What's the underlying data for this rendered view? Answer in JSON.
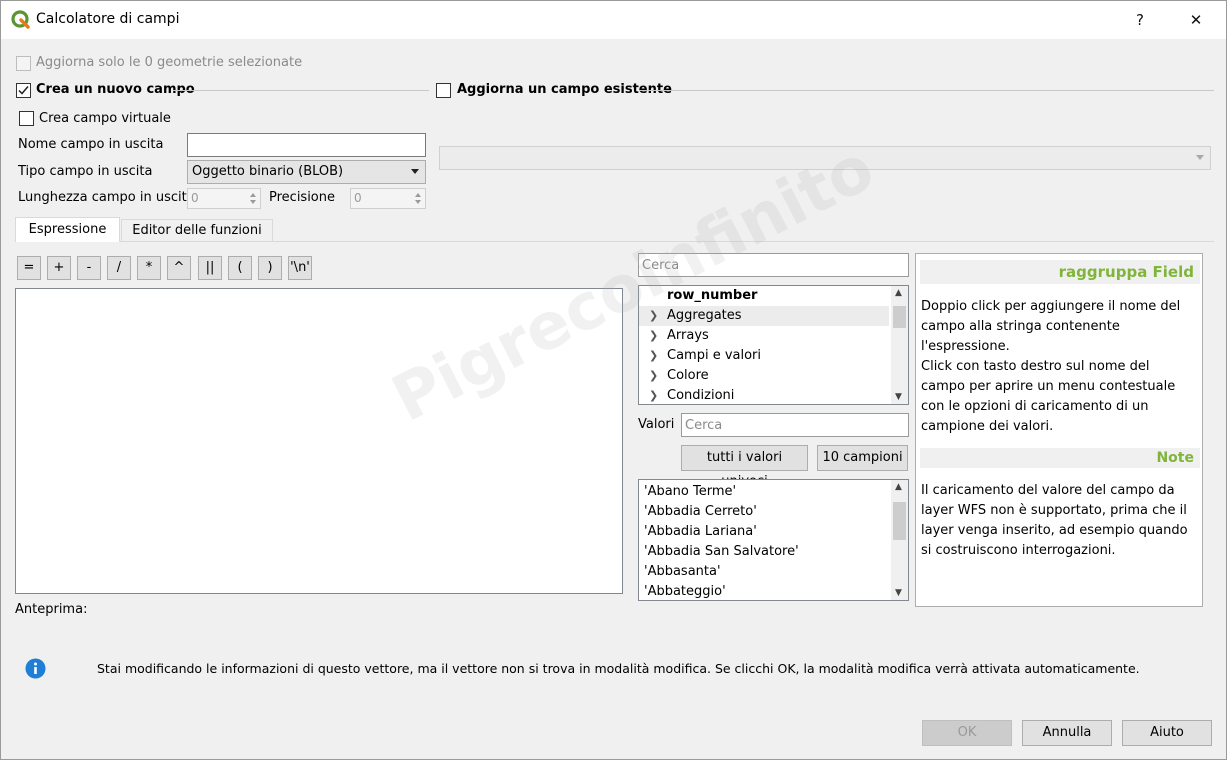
{
  "window": {
    "title": "Calcolatore di campi",
    "help_glyph": "?",
    "close_glyph": "✕"
  },
  "top": {
    "update_selected_label": "Aggiorna solo le 0 geometrie selezionate",
    "create_new_field_label": "Crea un nuovo campo",
    "update_existing_label": "Aggiorna un campo esistente",
    "virtual_field_label": "Crea campo virtuale"
  },
  "field_form": {
    "name_label": "Nome campo in uscita",
    "name_value": "",
    "type_label": "Tipo campo in uscita",
    "type_value": "Oggetto binario (BLOB)",
    "length_label": "Lunghezza campo in uscita",
    "length_value": "0",
    "precision_label": "Precisione",
    "precision_value": "0"
  },
  "tabs": [
    {
      "label": "Espressione",
      "active": true
    },
    {
      "label": "Editor delle funzioni",
      "active": false
    }
  ],
  "operators": [
    "=",
    "+",
    "-",
    "/",
    "*",
    "^",
    "||",
    "(",
    ")",
    "'\\n'"
  ],
  "function_list": {
    "search_placeholder": "Cerca",
    "items": [
      {
        "label": "row_number",
        "expandable": false,
        "bold": true
      },
      {
        "label": "Aggregates",
        "expandable": true,
        "bold": false
      },
      {
        "label": "Arrays",
        "expandable": true,
        "bold": false
      },
      {
        "label": "Campi e valori",
        "expandable": true,
        "bold": false
      },
      {
        "label": "Colore",
        "expandable": true,
        "bold": false
      },
      {
        "label": "Condizioni",
        "expandable": true,
        "bold": false
      }
    ]
  },
  "values": {
    "label": "Valori",
    "search_placeholder": "Cerca",
    "all_unique_button": "tutti i valori univoci",
    "samples_button": "10 campioni",
    "items": [
      "'Abano Terme'",
      "'Abbadia Cerreto'",
      "'Abbadia Lariana'",
      "'Abbadia San Salvatore'",
      "'Abbasanta'",
      "'Abbateggio'"
    ]
  },
  "help": {
    "heading": "raggruppa Field",
    "lines": [
      "Doppio click per aggiungere il nome del",
      "campo alla stringa contenente",
      "l'espressione.",
      "Click con tasto destro sul nome del",
      "campo per aprire un menu contestuale",
      "con le opzioni di caricamento di un",
      "campione dei valori."
    ],
    "note_heading": "Note",
    "note_lines": [
      "Il caricamento del valore del campo da",
      "layer WFS non è supportato, prima che il",
      "layer venga inserito, ad esempio quando",
      "si costruiscono interrogazioni."
    ]
  },
  "preview_label": "Anteprima:",
  "info_message": "Stai modificando le informazioni di questo vettore, ma il vettore non si trova in modalità modifica. Se clicchi OK, la modalità modifica verrà attivata automaticamente.",
  "buttons": {
    "ok": "OK",
    "cancel": "Annulla",
    "help": "Aiuto"
  },
  "colors": {
    "accent_green": "#80b53a",
    "info_blue": "#1f7fd6"
  },
  "watermark_text": "Pigrecoinfinito"
}
